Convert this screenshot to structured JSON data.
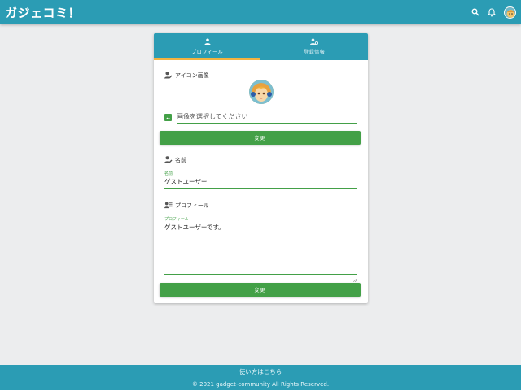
{
  "app": {
    "title": "ガジェコミ！"
  },
  "appbar": {
    "search_icon": "search-icon",
    "notification_icon": "bell-icon",
    "avatar_icon": "user-avatar"
  },
  "tabs": [
    {
      "label": "プロフィール",
      "icon": "person-icon",
      "active": true
    },
    {
      "label": "登録情報",
      "icon": "person-gear-icon",
      "active": false
    }
  ],
  "icon_section": {
    "label": "アイコン画像",
    "file_placeholder": "画像を選択してください",
    "button_label": "変更"
  },
  "name_section": {
    "label": "名前",
    "field_label": "名前",
    "value": "ゲストユーザー"
  },
  "profile_section": {
    "label": "プロフィール",
    "field_label": "プロフィール",
    "value": "ゲストユーザーです。",
    "button_label": "変更"
  },
  "footer": {
    "link": "使い方はこちら",
    "copyright": "© 2021 gadget-community All Rights Reserved."
  },
  "colors": {
    "primary": "#2b9cb4",
    "accent": "#43a047",
    "tab_indicator": "#f2b340",
    "background": "#ecedee"
  }
}
